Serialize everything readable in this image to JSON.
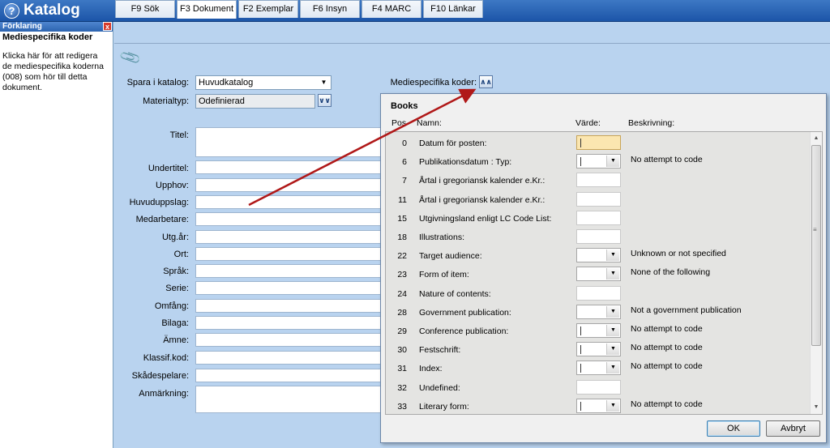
{
  "window": {
    "title": "Katalog",
    "help_glyph": "?"
  },
  "left_panel": {
    "header": "Förklaring",
    "close_glyph": "x",
    "title": "Mediespecifika koder",
    "text": "Klicka här för att redigera de mediespecifika koderna (008) som hör till detta dokument."
  },
  "tabs": [
    {
      "label": "F9 Sök"
    },
    {
      "label": "F3 Dokument"
    },
    {
      "label": "F2 Exemplar"
    },
    {
      "label": "F6 Insyn"
    },
    {
      "label": "F4 MARC"
    },
    {
      "label": "F10 Länkar"
    }
  ],
  "form": {
    "spara_label": "Spara i katalog:",
    "spara_value": "Huvudkatalog",
    "materialtyp_label": "Materialtyp:",
    "materialtyp_value": "Odefinierad",
    "mediespecifika_label": "Mediespecifika koder:",
    "fields": [
      {
        "label": "Titel:"
      },
      {
        "label": "Undertitel:"
      },
      {
        "label": "Upphov:"
      },
      {
        "label": "Huvuduppslag:"
      },
      {
        "label": "Medarbetare:"
      },
      {
        "label": "Utg.år:"
      },
      {
        "label": "Ort:"
      },
      {
        "label": "Språk:"
      },
      {
        "label": "Serie:"
      },
      {
        "label": "Omfång:"
      },
      {
        "label": "Bilaga:"
      },
      {
        "label": "Ämne:"
      },
      {
        "label": "Klassif.kod:"
      },
      {
        "label": "Skådespelare:"
      },
      {
        "label": "Anmärkning:"
      }
    ]
  },
  "popup": {
    "title": "Books",
    "headers": {
      "pos": "Pos",
      "name": "Namn:",
      "value": "Värde:",
      "desc": "Beskrivning:"
    },
    "rows": [
      {
        "pos": "0",
        "name": "Datum för posten:",
        "type": "text",
        "yellow": true,
        "desc": ""
      },
      {
        "pos": "6",
        "name": "Publikationsdatum : Typ:",
        "type": "combo",
        "caret": true,
        "desc": "No attempt to code"
      },
      {
        "pos": "7",
        "name": "Årtal i gregoriansk kalender e.Kr.:",
        "type": "text",
        "desc": ""
      },
      {
        "pos": "11",
        "name": "Årtal i gregoriansk kalender e.Kr.:",
        "type": "text",
        "desc": ""
      },
      {
        "pos": "15",
        "name": "Utgivningsland enligt LC Code List:",
        "type": "text",
        "desc": ""
      },
      {
        "pos": "18",
        "name": "Illustrations:",
        "type": "text",
        "desc": ""
      },
      {
        "pos": "22",
        "name": "Target audience:",
        "type": "combo",
        "caret": false,
        "desc": "Unknown or not specified"
      },
      {
        "pos": "23",
        "name": "Form of item:",
        "type": "combo",
        "caret": false,
        "desc": "None of the following"
      },
      {
        "pos": "24",
        "name": "Nature of contents:",
        "type": "text",
        "desc": ""
      },
      {
        "pos": "28",
        "name": "Government publication:",
        "type": "combo",
        "caret": false,
        "desc": "Not a government publication"
      },
      {
        "pos": "29",
        "name": "Conference publication:",
        "type": "combo",
        "caret": true,
        "desc": "No attempt to code"
      },
      {
        "pos": "30",
        "name": "Festschrift:",
        "type": "combo",
        "caret": true,
        "desc": "No attempt to code"
      },
      {
        "pos": "31",
        "name": "Index:",
        "type": "combo",
        "caret": true,
        "desc": "No attempt to code"
      },
      {
        "pos": "32",
        "name": "Undefined:",
        "type": "text",
        "desc": ""
      },
      {
        "pos": "33",
        "name": "Literary form:",
        "type": "combo",
        "caret": true,
        "desc": "No attempt to code"
      }
    ],
    "ok_label": "OK",
    "cancel_label": "Avbryt"
  },
  "colors": {
    "annotation_arrow": "#b01818",
    "titlebar": "#1c55a8",
    "background": "#b9d3ef"
  }
}
